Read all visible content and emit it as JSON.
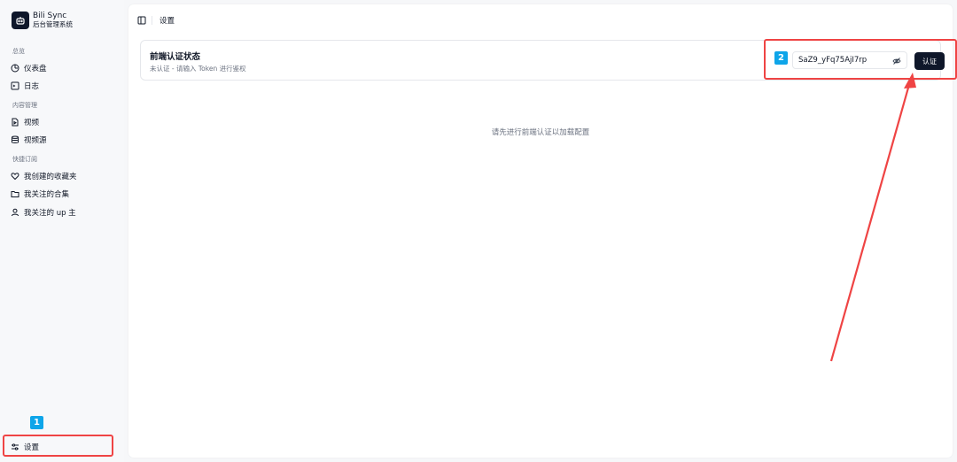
{
  "brand": {
    "name": "Bili Sync",
    "subtitle": "后台管理系统"
  },
  "sidebar": {
    "groups": [
      {
        "label": "总览",
        "items": [
          {
            "label": "仪表盘",
            "icon": "gauge-icon"
          },
          {
            "label": "日志",
            "icon": "terminal-icon"
          }
        ]
      },
      {
        "label": "内容管理",
        "items": [
          {
            "label": "视频",
            "icon": "file-video-icon"
          },
          {
            "label": "视频源",
            "icon": "database-icon"
          }
        ]
      },
      {
        "label": "快捷订阅",
        "items": [
          {
            "label": "我创建的收藏夹",
            "icon": "heart-icon"
          },
          {
            "label": "我关注的合集",
            "icon": "folder-icon"
          },
          {
            "label": "我关注的 up 主",
            "icon": "user-icon"
          }
        ]
      }
    ],
    "settings_label": "设置"
  },
  "topbar": {
    "breadcrumb": "设置"
  },
  "auth": {
    "title": "前端认证状态",
    "subtitle": "未认证 - 请输入 Token 进行鉴权",
    "token_value": "SaZ9_yFq75AjI7rp",
    "button_label": "认证"
  },
  "main": {
    "empty_message": "请先进行前端认证以加载配置"
  },
  "annotations": {
    "badge1": "1",
    "badge2": "2",
    "color": "#ef4444",
    "badge_color": "#0ea5e9"
  }
}
